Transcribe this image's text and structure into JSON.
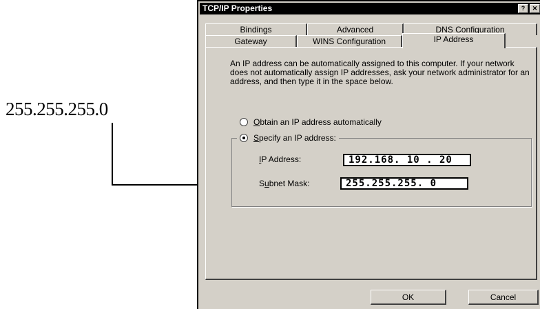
{
  "callout": {
    "text": "255.255.255.0"
  },
  "window": {
    "title": "TCP/IP Properties",
    "help_label": "?",
    "close_label": "✕"
  },
  "tabs": {
    "row1": [
      "Bindings",
      "Advanced",
      "DNS Configuration"
    ],
    "row2": [
      "Gateway",
      "WINS Configuration",
      "IP Address"
    ],
    "active": "IP Address"
  },
  "description": "An IP address can be automatically assigned to this computer. If your network does not automatically assign IP addresses, ask your network administrator for an address, and then type it in the space below.",
  "options": {
    "auto": {
      "label_prefix": "O",
      "label_rest": "btain an IP address automatically",
      "checked": false
    },
    "specify": {
      "label_prefix": "S",
      "label_rest": "pecify an IP address:",
      "checked": true
    }
  },
  "fields": {
    "ip": {
      "label_prefix": "I",
      "label_rest": "P Address:",
      "value": "192.168. 10 . 20"
    },
    "mask": {
      "label_pre": "S",
      "label_underlined": "u",
      "label_rest": "bnet Mask:",
      "value": "255.255.255.  0"
    }
  },
  "buttons": {
    "ok": "OK",
    "cancel": "Cancel"
  }
}
